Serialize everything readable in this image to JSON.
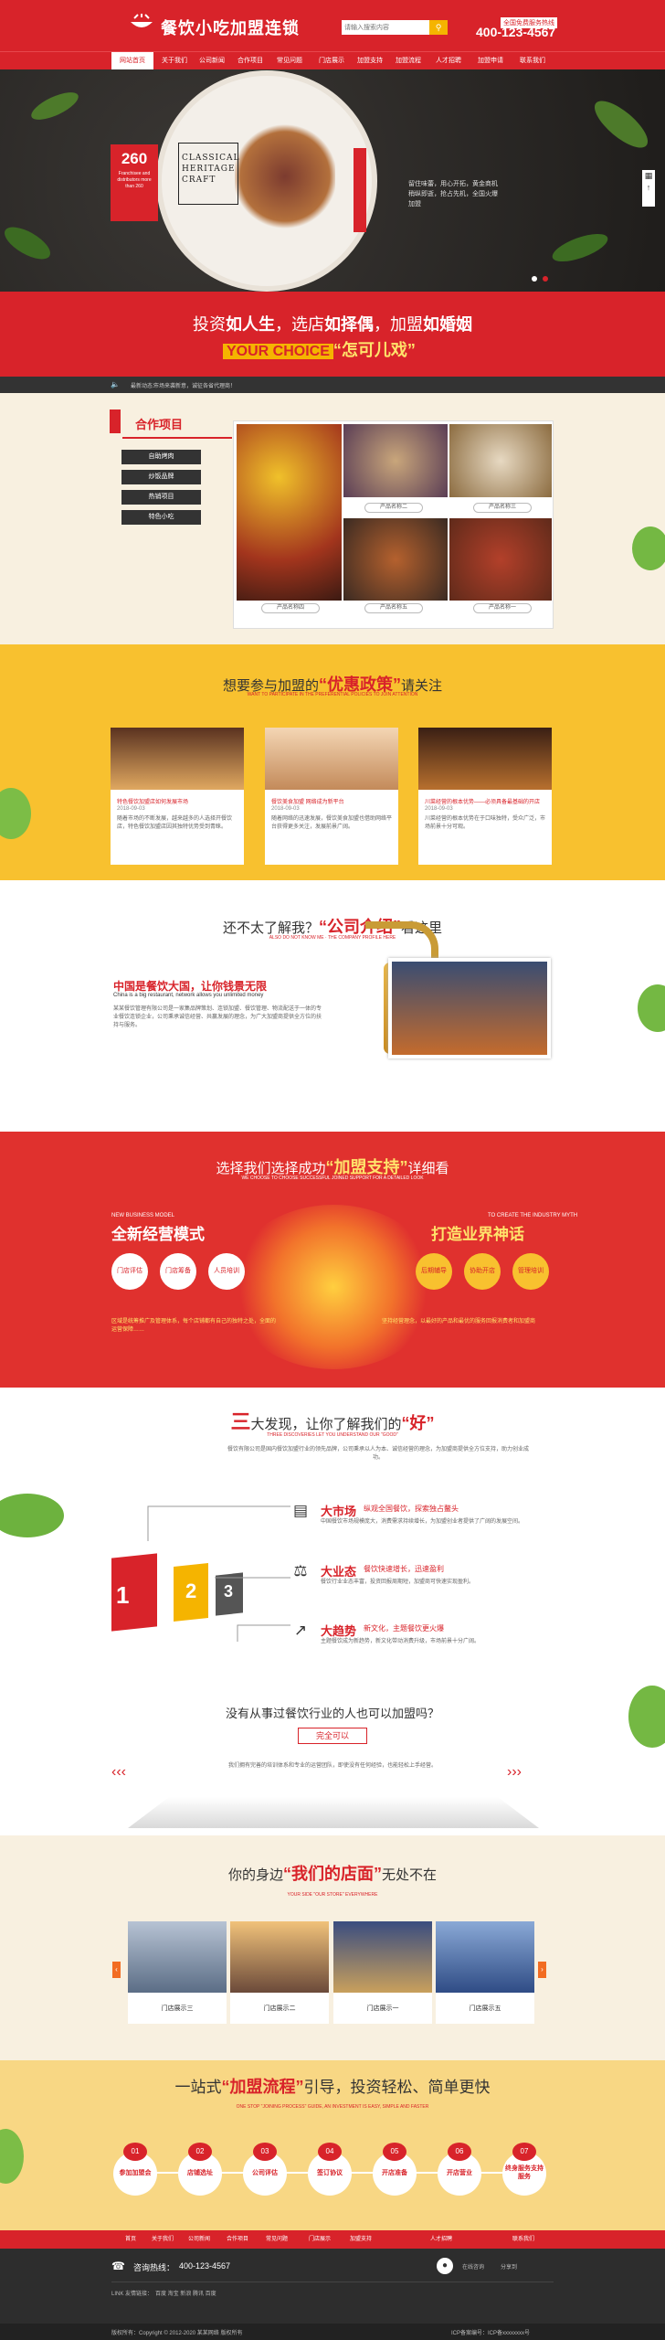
{
  "colors": {
    "brand_red": "#d8232a",
    "accent_yellow": "#f5b400",
    "cream": "#f8f0e0",
    "dark": "#333333"
  },
  "header": {
    "logo_text": "餐饮小吃加盟连锁",
    "search_placeholder": "请输入搜索内容",
    "search_icon": "search-icon",
    "hotline_label": "全国免费服务热线",
    "hotline_number": "400-123-4567"
  },
  "nav": [
    "网站首页",
    "关于我们",
    "公司新闻",
    "合作项目",
    "常见问题",
    "门店展示",
    "加盟支持",
    "加盟流程",
    "人才招聘",
    "加盟申请",
    "联系我们"
  ],
  "hero": {
    "badge_number": "260",
    "badge_text": "Franchisee and distributors more than 260",
    "frame_text": "CLASSICAL HERITAGE CRAFT",
    "side_text": "留住味蕾，用心开拓，黄金商机稍纵即逝，抢占先机，全国火爆加盟"
  },
  "slogan": {
    "line1_a": "投资",
    "line1_b": "如人生",
    "line1_c": "，选店",
    "line1_d": "如择偶",
    "line1_e": "，加盟",
    "line1_f": "如婚姻",
    "line2_yellow": "YOUR CHOICE",
    "line2_quote": "“怎可儿戏”"
  },
  "notice": {
    "label": "最新动态：",
    "text": "市场来袭新意，诚征各省代理商！"
  },
  "coop": {
    "title": "合作项目",
    "buttons": [
      "自助烤肉",
      "炒饭品牌",
      "热销项目",
      "特色小吃"
    ],
    "labels": [
      "产品名称四",
      "产品名称五",
      "产品名称三",
      "产品名称二",
      "产品名称一"
    ]
  },
  "policy": {
    "title_pre": "想要参与加盟的",
    "title_em": "“优惠政策”",
    "title_post": "请关注",
    "sub": "WANT TO PARTICIPATE IN THE PREFERENTIAL POLICIES TO JOIN ATTENTION",
    "cards": [
      {
        "title": "特色餐饮加盟店如何发展市场",
        "date": "2018-09-03",
        "text": "随着市场的不断发展，越来越多的人选择开餐饮店，特色餐饮加盟店因其独特优势受到青睐。"
      },
      {
        "title": "餐饮美食加盟 网络成为新平台",
        "date": "2018-09-03",
        "text": "随着网络的迅速发展，餐饮美食加盟也借助网络平台获得更多关注，发展前景广阔。"
      },
      {
        "title": "川菜经营的根本优势——必须具备最基础的开店",
        "date": "2018-09-03",
        "text": "川菜经营的根本优势在于口味独特，受众广泛，市场前景十分可观。"
      }
    ]
  },
  "intro": {
    "title_pre": "还不太了解我？",
    "title_em": "“公司介绍”",
    "title_post": "看这里",
    "sub": "ALSO DO NOT KNOW ME · THE COMPANY PROFILE HERE",
    "heading": "中国是餐饮大国，让你钱景无限",
    "en": "China is a big restaurant, network allows you unlimited money",
    "body": "某某餐饮管理有限公司是一家集品牌策划、连锁加盟、餐饮管理、物流配送于一体的专业餐饮连锁企业，公司秉承诚信经营、共赢发展的理念，为广大加盟商提供全方位的扶持与服务。"
  },
  "support": {
    "title_pre": "选择我们选择成功",
    "title_em": "“加盟支持”",
    "title_post": "详细看",
    "sub": "WE CHOOSE TO CHOOSE SUCCESSFUL JOINED SUPPORT FOR A DETAILED LOOK",
    "left_en": "NEW BUSINESS MODEL",
    "left_title": "全新经营模式",
    "left_circles": [
      "门店评估",
      "门店筹备",
      "人员培训"
    ],
    "left_text": "区域是统筹推广及管理体系，每个店铺都有自己的独特之处，全面的运营保障……",
    "right_en": "TO CREATE THE INDUSTRY MYTH",
    "right_title": "打造业界神话",
    "right_circles": [
      "后期辅导",
      "协助开店",
      "管理培训"
    ],
    "right_text": "坚持经营理念，以最好的产品和最优的服务回报消费者和加盟商"
  },
  "three": {
    "title_pre": "三",
    "title_mid": "大发现，让你了解我们的",
    "title_em": "“好”",
    "sub": "THREE DISCOVERIES LET YOU UNDERSTAND OUR \"GOOD\"",
    "intro": "餐饮有限公司是国内餐饮加盟行业的领先品牌，公司秉承以人为本、诚信经营的理念，为加盟商提供全方位支持，助力创业成功。",
    "rows": [
      {
        "icon": "chart-icon",
        "h": "大市场",
        "s": "纵观全国餐饮，探索独占鳌头",
        "p": "中国餐饮市场规模庞大，消费需求持续增长，为加盟创业者提供了广阔的发展空间。"
      },
      {
        "icon": "scale-icon",
        "h": "大业态",
        "s": "餐饮快速增长，迅速盈利",
        "p": "餐饮行业业态丰富，投资回报周期短，加盟商可快速实现盈利。"
      },
      {
        "icon": "growth-icon",
        "h": "大趋势",
        "s": "新文化，主题餐饮更火爆",
        "p": "主题餐饮成为新趋势，新文化带动消费升级，市场前景十分广阔。"
      }
    ],
    "pillar_nums": [
      "1",
      "2",
      "3"
    ],
    "question": "没有从事过餐饮行业的人也可以加盟吗？",
    "answer_btn": "完全可以",
    "answer_text": "我们拥有完善的培训体系和专业的运营团队，即使没有任何经验，也能轻松上手经营。"
  },
  "stores": {
    "title_pre": "你的身边",
    "title_em": "“我们的店面”",
    "title_post": "无处不在",
    "sub": "YOUR SIDE \"OUR STORE\" EVERYWHERE",
    "items": [
      "门店展示三",
      "门店展示二",
      "门店展示一",
      "门店展示五"
    ]
  },
  "process": {
    "title_pre": "一站式",
    "title_em": "“加盟流程”",
    "title_post": "引导，投资轻松、简单更快",
    "sub": "ONE STOP \"JOINING PROCESS\" GUIDE, AN INVESTMENT IS EASY, SIMPLE AND FASTER",
    "steps": [
      {
        "n": "01",
        "l": "参加加盟会"
      },
      {
        "n": "02",
        "l": "店铺选址"
      },
      {
        "n": "03",
        "l": "公司评估"
      },
      {
        "n": "04",
        "l": "签订协议"
      },
      {
        "n": "05",
        "l": "开店准备"
      },
      {
        "n": "06",
        "l": "开店营业"
      },
      {
        "n": "07",
        "l": "终身服务支持服务"
      }
    ]
  },
  "footer": {
    "nav": [
      "首页",
      "关于我们",
      "公司新闻",
      "合作项目",
      "常见问题",
      "门店展示",
      "加盟支持",
      "人才招聘",
      "联系我们"
    ],
    "hotline_label": "咨询热线：",
    "hotline": "400-123-4567",
    "qq": "在线咨询",
    "share": "分享到",
    "links": "LINK 友情链接：",
    "link_items": "百度 淘宝 新浪 腾讯 百度",
    "copyright": "版权所有：Copyright © 2012-2020 某某网络 版权所有",
    "icp": "ICP备案编号：ICP备xxxxxxxx号"
  }
}
